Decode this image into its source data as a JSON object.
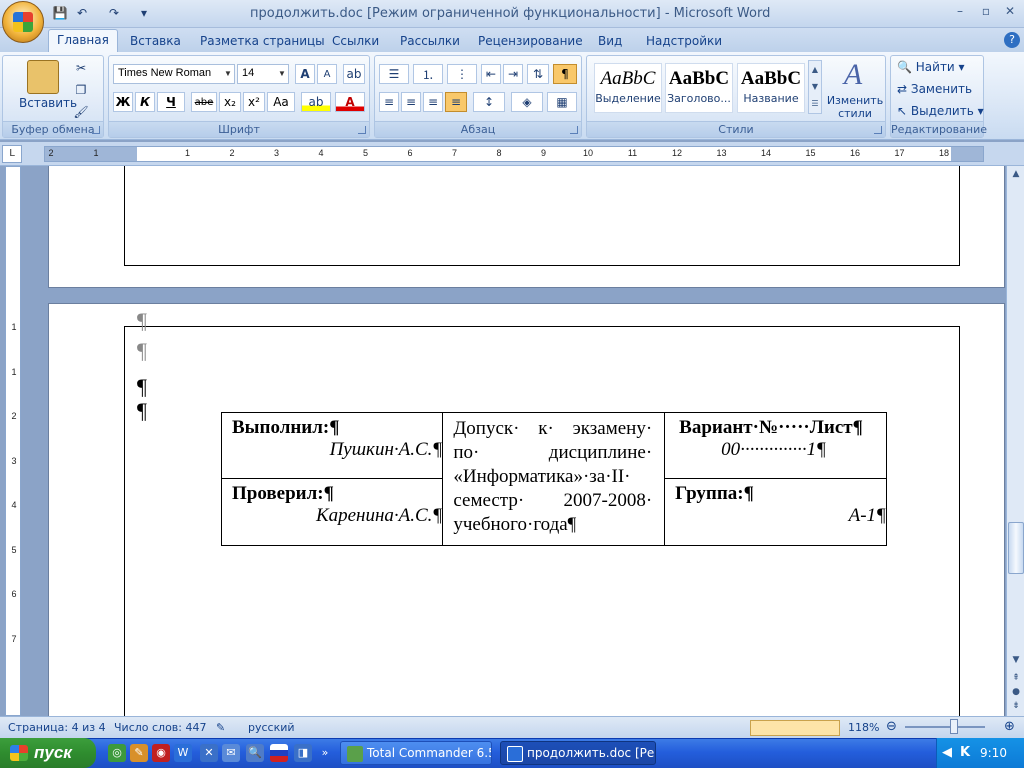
{
  "window": {
    "title": "продолжить.doc [Режим ограниченной функциональности] - Microsoft Word",
    "controls": [
      "–",
      "▫",
      "✕"
    ]
  },
  "quick_access": {
    "save": "💾",
    "undo": "↶",
    "redo": "↷",
    "customize": "▾"
  },
  "tabs": [
    {
      "label": "Главная",
      "active": true
    },
    {
      "label": "Вставка"
    },
    {
      "label": "Разметка страницы"
    },
    {
      "label": "Ссылки"
    },
    {
      "label": "Рассылки"
    },
    {
      "label": "Рецензирование"
    },
    {
      "label": "Вид"
    },
    {
      "label": "Надстройки"
    }
  ],
  "ribbon": {
    "clipboard": {
      "label": "Буфер обмена",
      "paste": "Вставить"
    },
    "font": {
      "label": "Шрифт",
      "name": "Times New Roman",
      "size": "14",
      "bold": "Ж",
      "italic": "К",
      "underline": "Ч",
      "strike": "abe",
      "sub": "x₂",
      "sup": "x²",
      "case": "Aa",
      "grow": "A",
      "shrink": "A"
    },
    "paragraph": {
      "label": "Абзац",
      "show_marks": "¶"
    },
    "styles": {
      "label": "Стили",
      "items": [
        {
          "sample": "AaBbC",
          "name": "Выделение"
        },
        {
          "sample": "AaBbC",
          "name": "Заголово..."
        },
        {
          "sample": "AaBbC",
          "name": "Название"
        }
      ],
      "change": "Изменить стили"
    },
    "editing": {
      "label": "Редактирование",
      "find": "Найти",
      "replace": "Заменить",
      "select": "Выделить"
    }
  },
  "ruler": {
    "numbers": [
      "2",
      "1",
      "1",
      "2",
      "3",
      "4",
      "5",
      "6",
      "7",
      "8",
      "9",
      "10",
      "11",
      "12",
      "13",
      "14",
      "15",
      "16",
      "17",
      "18"
    ],
    "vnumbers": [
      "1",
      "1",
      "2",
      "3",
      "4",
      "5",
      "6",
      "7"
    ]
  },
  "document": {
    "stamp": {
      "performed_label": "Выполнил:¶",
      "performed_name": "Пушкин·А.С.¶",
      "checked_label": "Проверил:¶",
      "checked_name": "Каренина·А.С.¶",
      "admission": "Допуск· к· экзамену· по· дисциплине· «Информатика»·за·II· семестр· 2007-2008· учебного·года¶",
      "variant_label": "Вариант·№·····Лист¶",
      "variant_value": "00··············1¶",
      "group_label": "Группа:¶",
      "group_value": "А-1¶"
    },
    "pilcrow": "¶"
  },
  "statusbar": {
    "page": "Страница: 4 из 4",
    "words": "Число слов: 447",
    "language": "русский",
    "zoom": "118%"
  },
  "taskbar": {
    "start": "пуск",
    "tasks": [
      {
        "label": "Total Commander 6.5...",
        "active": false
      },
      {
        "label": "продолжить.doc [Ре...",
        "active": true
      }
    ],
    "clock": "9:10"
  }
}
